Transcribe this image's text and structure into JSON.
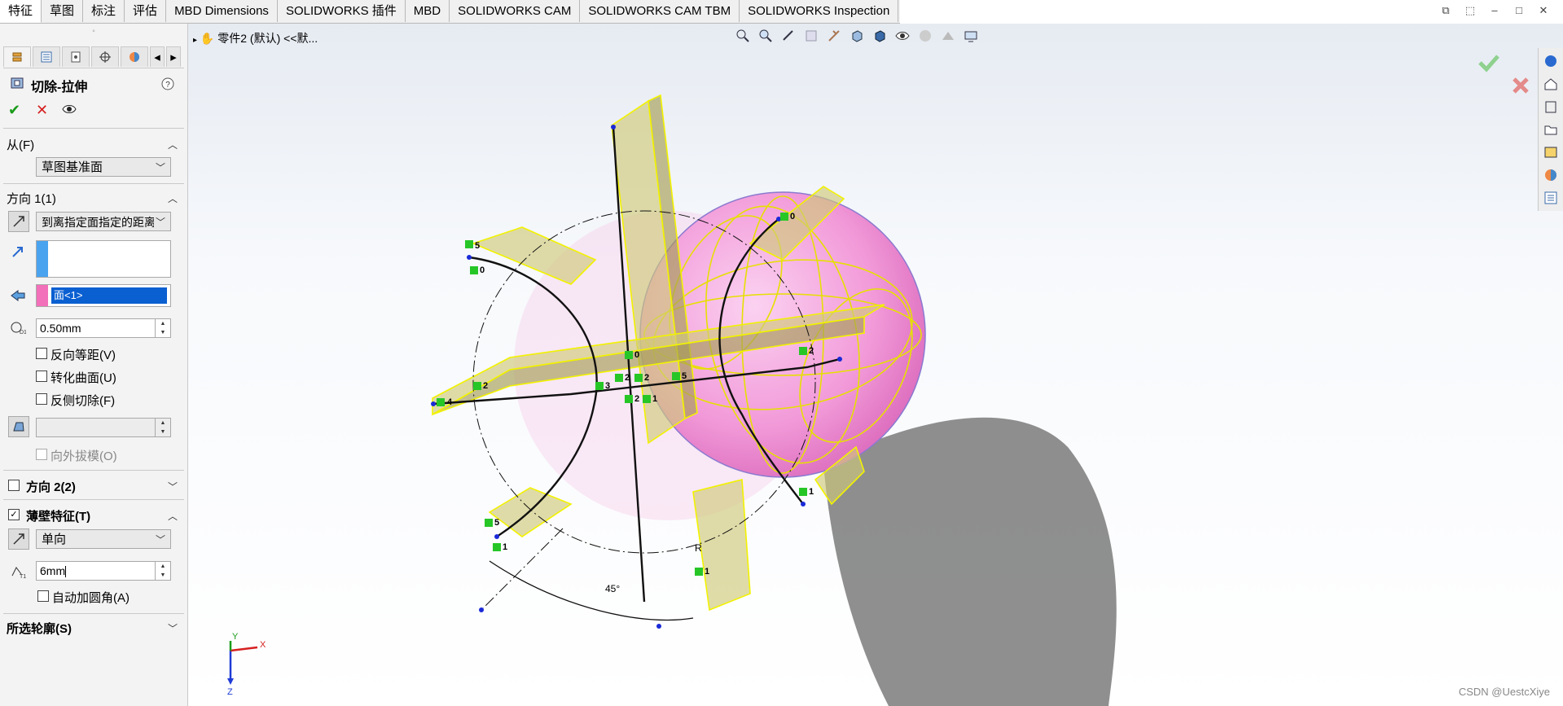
{
  "tabs": [
    "特征",
    "草图",
    "标注",
    "评估",
    "MBD Dimensions",
    "SOLIDWORKS 插件",
    "MBD",
    "SOLIDWORKS CAM",
    "SOLIDWORKS CAM TBM",
    "SOLIDWORKS Inspection"
  ],
  "active_tab": "特征",
  "breadcrumb": "零件2 (默认) <<默...",
  "feature": {
    "title": "切除-拉伸",
    "from": {
      "label": "从(F)",
      "value": "草图基准面"
    },
    "dir1": {
      "label": "方向 1(1)",
      "end_condition": "到离指定面指定的距离",
      "face_ref": "面<1>",
      "offset": "0.50mm",
      "reverse_offset": "反向等距(V)",
      "translate_surface": "转化曲面(U)",
      "flip_side": "反侧切除(F)",
      "draft_outward": "向外拔模(O)"
    },
    "dir2": {
      "label": "方向 2(2)"
    },
    "thin": {
      "label": "薄壁特征(T)",
      "type": "单向",
      "thickness": "6mm",
      "auto_fillet": "自动加圆角(A)"
    },
    "contours": {
      "label": "所选轮廓(S)"
    }
  },
  "view_labels": {
    "dims": [
      "5",
      "0",
      "0",
      "5",
      "1",
      "2",
      "2",
      "3",
      "0",
      "5",
      "2",
      "1",
      "4",
      "2",
      "2",
      "1",
      "1"
    ],
    "angle": "45°",
    "radius": "R"
  },
  "axes": {
    "x": "X",
    "y": "Y",
    "z": "Z"
  },
  "watermark": "CSDN @UestcXiye",
  "colors": {
    "sphere": "#f28fd6",
    "feature_outline": "#f2f200",
    "accept": "#1a9b1a",
    "cancel": "#d62020"
  }
}
